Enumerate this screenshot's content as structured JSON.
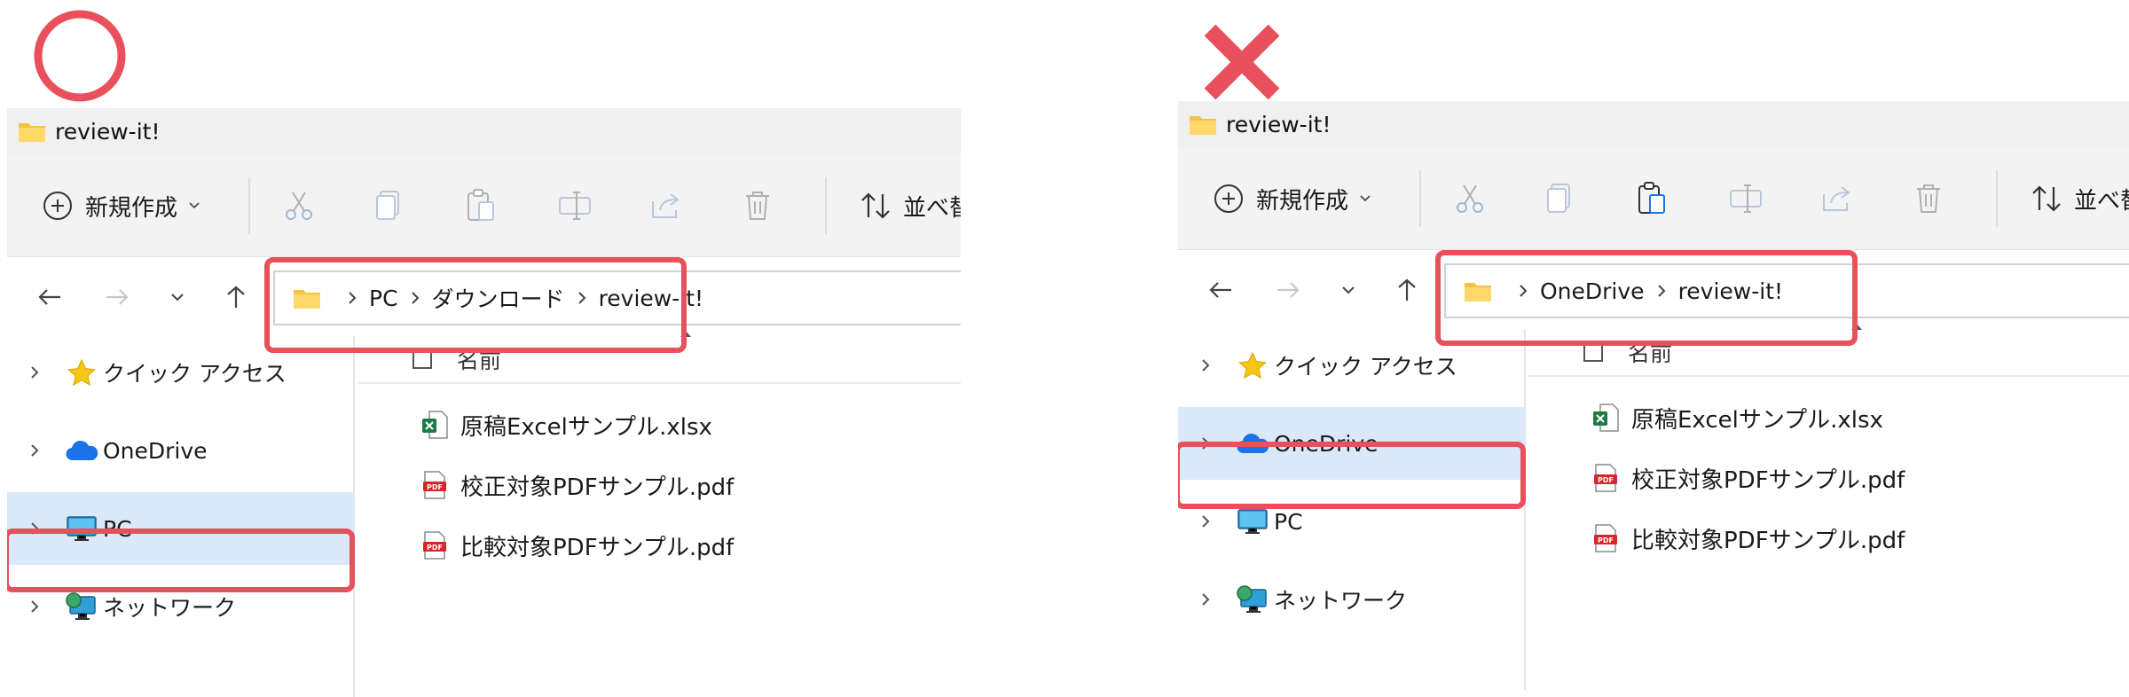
{
  "marks": {
    "good": "correct-circle-mark",
    "bad": "incorrect-cross-mark",
    "color": "#e8505b"
  },
  "colors": {
    "selected": "#dbe8f8",
    "folder": "#f5c242",
    "onedrive": "#1a73e8"
  },
  "left": {
    "window_title": "review-it!",
    "toolbar": {
      "new_label": "新規作成",
      "sort_label": "並べ替"
    },
    "address": {
      "segments": [
        "PC",
        "ダウンロード",
        "review-it!"
      ]
    },
    "sidebar": {
      "items": [
        {
          "label": "クイック アクセス",
          "icon": "star-icon"
        },
        {
          "label": "OneDrive",
          "icon": "cloud-icon"
        },
        {
          "label": "PC",
          "icon": "monitor-icon",
          "selected": true
        },
        {
          "label": "ネットワーク",
          "icon": "network-icon"
        }
      ]
    },
    "content": {
      "column_name": "名前",
      "files": [
        {
          "name": "原稿Excelサンプル.xlsx",
          "icon": "excel-icon"
        },
        {
          "name": "校正対象PDFサンプル.pdf",
          "icon": "pdf-icon"
        },
        {
          "name": "比較対象PDFサンプル.pdf",
          "icon": "pdf-icon"
        }
      ]
    }
  },
  "right": {
    "window_title": "review-it!",
    "toolbar": {
      "new_label": "新規作成",
      "sort_label": "並べ替"
    },
    "address": {
      "segments": [
        "OneDrive",
        "review-it!"
      ]
    },
    "sidebar": {
      "items": [
        {
          "label": "クイック アクセス",
          "icon": "star-icon"
        },
        {
          "label": "OneDrive",
          "icon": "cloud-icon",
          "selected": true
        },
        {
          "label": "PC",
          "icon": "monitor-icon"
        },
        {
          "label": "ネットワーク",
          "icon": "network-icon"
        }
      ]
    },
    "content": {
      "column_name": "名前",
      "files": [
        {
          "name": "原稿Excelサンプル.xlsx",
          "icon": "excel-icon"
        },
        {
          "name": "校正対象PDFサンプル.pdf",
          "icon": "pdf-icon"
        },
        {
          "name": "比較対象PDFサンプル.pdf",
          "icon": "pdf-icon"
        }
      ]
    }
  }
}
